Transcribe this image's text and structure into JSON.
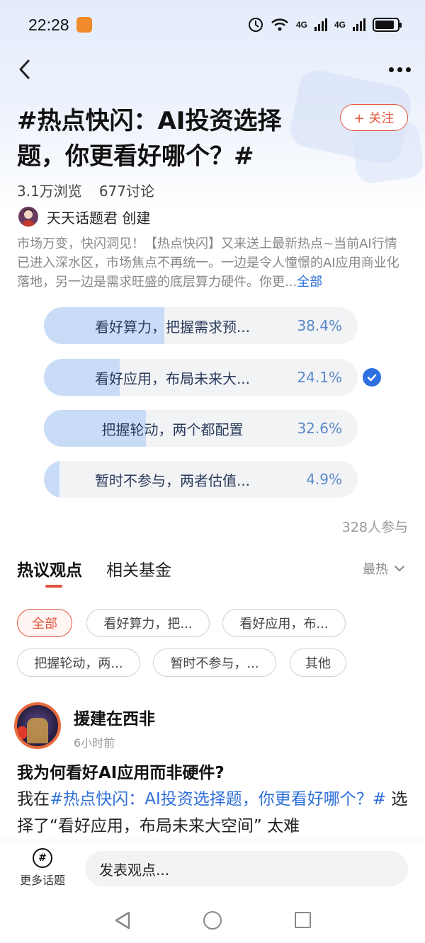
{
  "status_bar": {
    "time": "22:28",
    "signal1": "4G",
    "signal2": "4G"
  },
  "header": {
    "title": "#热点快闪：AI投资选择题，你更看好哪个？#",
    "follow_label": "+ 关注",
    "views": "3.1万浏览",
    "discussions": "677讨论",
    "creator": "天天话题君 创建",
    "description": "市场万变，快闪洞见！【热点快闪】又来送上最新热点~当前AI行情已进入深水区，市场焦点不再统一。一边是令人憧憬的AI应用商业化落地，另一边是需求旺盛的底层算力硬件。你更...",
    "expand_label": "全部"
  },
  "poll": {
    "options": [
      {
        "label": "看好算力，把握需求预...",
        "percent": "38.4%",
        "fraction": 0.384,
        "selected": false
      },
      {
        "label": "看好应用，布局未来大...",
        "percent": "24.1%",
        "fraction": 0.241,
        "selected": true
      },
      {
        "label": "把握轮动，两个都配置",
        "percent": "32.6%",
        "fraction": 0.326,
        "selected": false
      },
      {
        "label": "暂时不参与，两者估值...",
        "percent": "4.9%",
        "fraction": 0.049,
        "selected": false
      }
    ],
    "participants": "328人参与"
  },
  "tabs": [
    {
      "label": "热议观点",
      "active": true
    },
    {
      "label": "相关基金",
      "active": false
    }
  ],
  "sort_label": "最热",
  "filters": [
    "全部",
    "看好算力，把...",
    "看好应用，布...",
    "把握轮动，两...",
    "暂时不参与，...",
    "其他"
  ],
  "post": {
    "username": "援建在西非",
    "time": "6小时前",
    "title": "我为何看好AI应用而非硬件?",
    "body_prefix": "我在",
    "body_tag": "#热点快闪：AI投资选择题，你更看好哪个？#",
    "body_suffix": " 选择了“看好应用，布局未来大空间” 太难"
  },
  "bottom": {
    "more_topics_label": "更多话题",
    "comment_placeholder": "发表观点..."
  },
  "colors": {
    "accent": "#e2553c",
    "link": "#2d6fd8",
    "poll_fill": "#c8dcf7",
    "check": "#2f6fe0"
  }
}
